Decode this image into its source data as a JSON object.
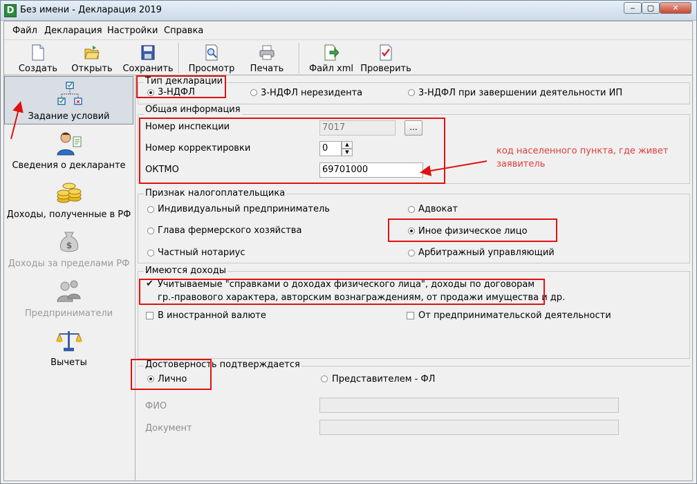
{
  "window": {
    "app_icon": "D",
    "title": "Без имени - Декларация 2019",
    "controls": {
      "minimize": "‒",
      "maximize": "▢",
      "close": "✕"
    }
  },
  "menu": [
    "Файл",
    "Декларация",
    "Настройки",
    "Справка"
  ],
  "toolbar": [
    {
      "label": "Создать",
      "icon": "new-document-icon"
    },
    {
      "label": "Открыть",
      "icon": "open-folder-icon"
    },
    {
      "label": "Сохранить",
      "icon": "floppy-disk-icon"
    },
    {
      "label": "Просмотр",
      "icon": "preview-magnifier-icon"
    },
    {
      "label": "Печать",
      "icon": "printer-icon"
    },
    {
      "label": "Файл xml",
      "icon": "export-xml-icon"
    },
    {
      "label": "Проверить",
      "icon": "check-document-icon"
    }
  ],
  "sidebar": [
    {
      "label": "Задание условий",
      "icon": "conditions-tree-icon",
      "active": true
    },
    {
      "label": "Сведения о декларанте",
      "icon": "person-icon"
    },
    {
      "label": "Доходы, полученные в РФ",
      "icon": "coins-icon"
    },
    {
      "label": "Доходы за пределами РФ",
      "icon": "money-bag-icon",
      "disabled": true
    },
    {
      "label": "Предприниматели",
      "icon": "entrepreneurs-icon",
      "disabled": true
    },
    {
      "label": "Вычеты",
      "icon": "scales-icon"
    }
  ],
  "declaration_type": {
    "title": "Тип декларации",
    "options": [
      "3-НДФЛ",
      "3-НДФЛ нерезидента",
      "3-НДФЛ при завершении деятельности ИП"
    ],
    "selected": "3-НДФЛ"
  },
  "general_info": {
    "title": "Общая информация",
    "inspection_label": "Номер инспекции",
    "inspection_value": "7017",
    "browse_button": "...",
    "correction_label": "Номер корректировки",
    "correction_value": "0",
    "oktmo_label": "ОКТМО",
    "oktmo_value": "69701000"
  },
  "taxpayer": {
    "title": "Признак налогоплательщика",
    "options": [
      "Индивидуальный предприниматель",
      "Адвокат",
      "Глава фермерского хозяйства",
      "Иное физическое лицо",
      "Частный нотариус",
      "Арбитражный управляющий"
    ],
    "selected": "Иное физическое лицо"
  },
  "income": {
    "title": "Имеются доходы",
    "main_line1": "Учитываемые \"справками о доходах физического лица\", доходы по договорам",
    "main_line2": "гр.-правового характера, авторским вознаграждениям, от продажи имущества и др.",
    "main_checked": true,
    "foreign": "В иностранной валюте",
    "foreign_checked": false,
    "business": "От предпринимательской деятельности",
    "business_checked": false
  },
  "confirmation": {
    "title": "Достоверность подтверждается",
    "personal": "Лично",
    "representative": "Представителем - ФЛ",
    "selected": "Лично",
    "fio_label": "ФИО",
    "fio_value": "",
    "document_label": "Документ",
    "document_value": ""
  },
  "annotation": {
    "line1": "код населенного пункта, где живет",
    "line2": "заявитель",
    "color": "#e23b3b"
  },
  "colors": {
    "annotation_red": "#e01010",
    "active_sidebar": "#d9dee5"
  }
}
